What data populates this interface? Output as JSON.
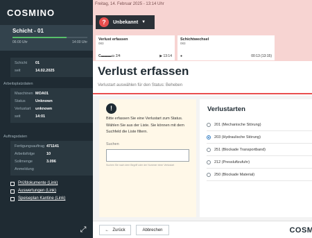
{
  "sidebar": {
    "logo": "COSMINO",
    "shift": {
      "name": "Schicht - 01",
      "start": "06:00 Uhr",
      "end": "14:00 Uhr",
      "progress": 0.72
    },
    "shift_info": [
      {
        "key": "Schicht",
        "value": "01"
      },
      {
        "key": "seit",
        "value": "14.02.2025"
      }
    ],
    "workplace_title": "Arbeitsplatzdaten",
    "workplace": [
      {
        "key": "Maschinen",
        "value": "MOA01"
      },
      {
        "key": "Status",
        "value": "Unknown"
      },
      {
        "key": "Verlustart",
        "value": "unknown"
      },
      {
        "key": "seit",
        "value": "14:01"
      }
    ],
    "order_title": "Auftragsdaten",
    "order": [
      {
        "key": "Fertigungsauftrag",
        "value": "471141"
      },
      {
        "key": "Arbeitsfolge",
        "value": "10"
      },
      {
        "key": "Sollmenge",
        "value": "3.096"
      },
      {
        "key": "Anmeldung",
        "value": ""
      }
    ],
    "links": [
      "Prüfdokumente (Link)",
      "Auswertungen (Link)",
      "Speiseplan Kantine (Link)"
    ],
    "expand_icon": "expand-icon",
    "colors": {
      "background": "#1f2b33",
      "progress": "#58c06a"
    }
  },
  "header": {
    "datetime": "Freitag, 14. Februar 2025 - 13:14 Uhr",
    "status_label": "Unbekannt",
    "status_icon": "?",
    "status_color": "#e84e4e",
    "cards": [
      {
        "title": "Verlust erfassen",
        "subtitle": "083",
        "foot_left": "2/4",
        "foot_right": "▶ 13:14"
      },
      {
        "title": "Schichtwechsel",
        "subtitle": "083",
        "foot_left": "●",
        "foot_right": "00:13 (13:15)"
      }
    ]
  },
  "page": {
    "title": "Verlust erfassen",
    "subtitle": "Verlustart auswählen für den Status: Beheben",
    "accent": "#e84e4e"
  },
  "instructions": {
    "text": "Bitte erfassen Sie eine Verlustart zum Status. Wählen Sie aus der Liste. Sie können mit dem Suchfeld die Liste filtern.",
    "search_label": "Suchen",
    "search_placeholder": "",
    "search_hint": "Suchen Sie nach dem Begriff oder der Nummer einer Verlustart"
  },
  "loss_types": {
    "title": "Verlustarten",
    "options": [
      {
        "label": "201 (Mechanische Störung)",
        "selected": false
      },
      {
        "label": "203 (Hydraulische Störung)",
        "selected": true
      },
      {
        "label": "251 (Blockade Transportband)",
        "selected": false
      },
      {
        "label": "212 (Pressluftzufuhr)",
        "selected": false
      },
      {
        "label": "250 (Blockade Material)",
        "selected": false
      }
    ]
  },
  "footer": {
    "back_label": "Zurück",
    "back_icon": "←",
    "cancel_label": "Abbrechen",
    "brand": "COSMI"
  }
}
